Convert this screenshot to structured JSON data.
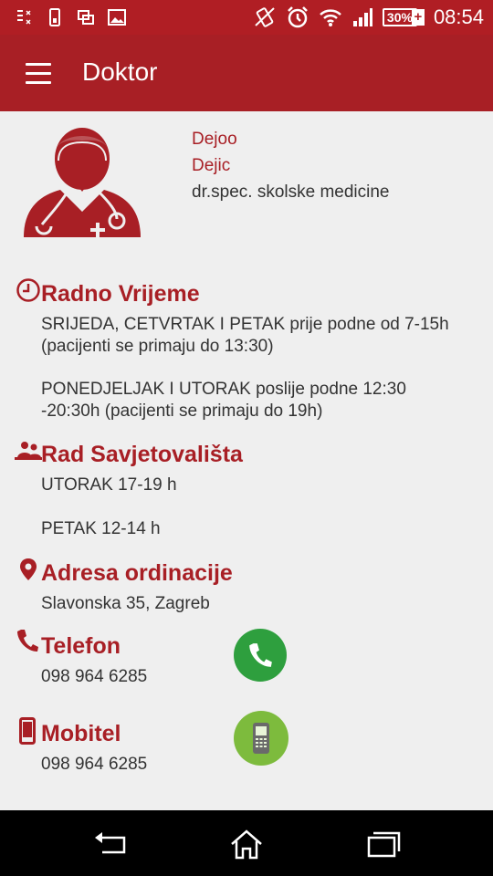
{
  "status_bar": {
    "battery": "30%",
    "time": "08:54",
    "icons": [
      "data-transfer-icon",
      "phone-icon",
      "screen-icon",
      "image-icon",
      "vibrate-icon",
      "alarm-icon",
      "wifi-icon",
      "signal-icon",
      "battery-icon"
    ]
  },
  "app_bar": {
    "title": "Doktor"
  },
  "doctor": {
    "first_name": "Dejoo",
    "last_name": "Dejic",
    "specialty": "dr.spec. skolske medicine"
  },
  "working_hours": {
    "title": "Radno Vrijeme",
    "line1": "SRIJEDA, CETVRTAK I PETAK prije podne od 7-15h",
    "line2": "(pacijenti se primaju do 13:30)",
    "line3": "PONEDJELJAK I UTORAK poslije podne 12:30",
    "line4": "-20:30h (pacijenti se primaju do 19h)"
  },
  "counseling": {
    "title": "Rad Savjetovališta",
    "line1": "UTORAK 17-19 h",
    "line2": "PETAK 12-14 h"
  },
  "address": {
    "title": "Adresa ordinacije",
    "value": "Slavonska 35, Zagreb"
  },
  "phone": {
    "title": "Telefon",
    "value": "098 964 6285"
  },
  "mobile": {
    "title": "Mobitel",
    "value": "098 964 6285"
  },
  "colors": {
    "primary": "#a81f25",
    "status_bar": "#b01e24",
    "call_green": "#2e9f3e",
    "mobile_green": "#7dbb3d"
  }
}
